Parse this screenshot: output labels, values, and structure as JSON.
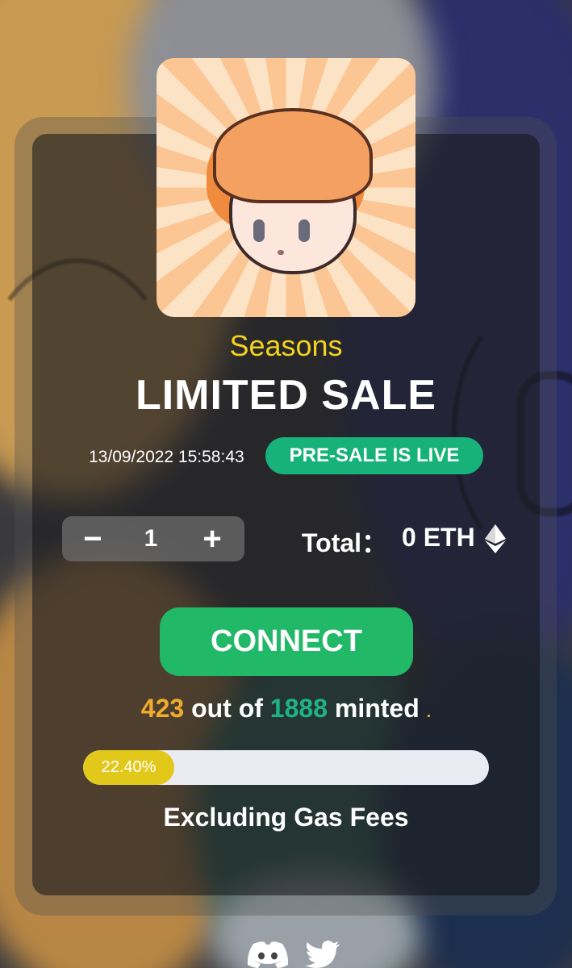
{
  "collection_name": "Seasons",
  "sale_title": "LIMITED SALE",
  "timestamp": "13/09/2022 15:58:43",
  "status_badge": "PRE-SALE IS LIVE",
  "stepper": {
    "minus": "−",
    "quantity": "1",
    "plus": "+"
  },
  "total": {
    "label": "Total：",
    "value": "0 ETH",
    "currency_icon": "ethereum-icon"
  },
  "connect_button": "CONNECT",
  "mint_progress": {
    "minted": "423",
    "out_of": "out of",
    "supply": "1888",
    "minted_word": "minted",
    "dot": ".",
    "percent_label": "22.40%",
    "fraction": 0.224
  },
  "gas_note": "Excluding Gas Fees",
  "social_icons": [
    "discord-icon",
    "twitter-icon"
  ],
  "colors": {
    "accent_yellow": "#f3d11e",
    "status_green": "#16b27a",
    "connect_green": "#21b867",
    "minted_orange": "#f0ac2c",
    "supply_green": "#1eb482",
    "progress_fill": "#e3c81c",
    "progress_track": "#ebebf3"
  }
}
